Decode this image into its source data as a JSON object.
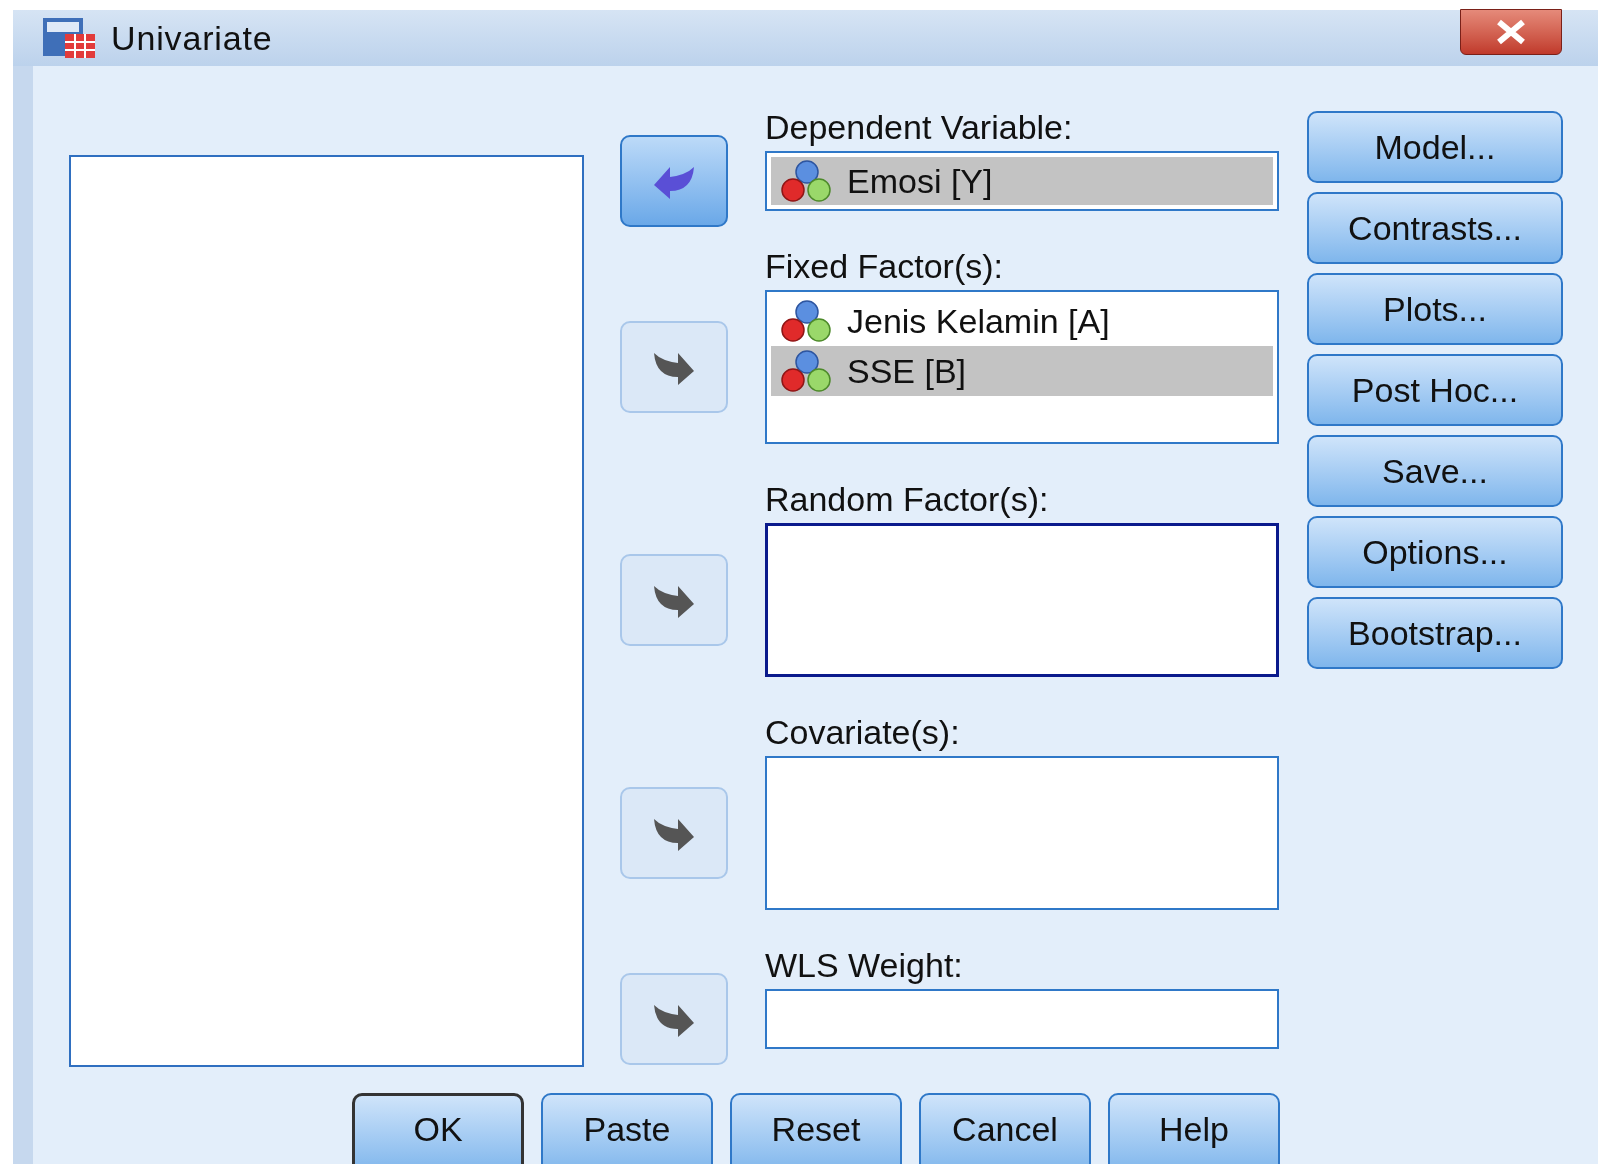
{
  "window": {
    "title": "Univariate"
  },
  "targets": [
    {
      "kind": "single",
      "label": "Dependent Variable:",
      "focused": false,
      "arrow": {
        "reversed": true,
        "disabled": false
      },
      "items": [
        {
          "name": "Emosi [Y]",
          "selected": true
        }
      ]
    },
    {
      "kind": "list",
      "label": "Fixed Factor(s):",
      "focused": false,
      "arrow": {
        "reversed": false,
        "disabled": true
      },
      "items": [
        {
          "name": "Jenis Kelamin [A]",
          "selected": false
        },
        {
          "name": "SSE [B]",
          "selected": true
        }
      ]
    },
    {
      "kind": "list",
      "label": "Random Factor(s):",
      "focused": true,
      "arrow": {
        "reversed": false,
        "disabled": true
      }
    },
    {
      "kind": "list",
      "label": "Covariate(s):",
      "focused": false,
      "arrow": {
        "reversed": false,
        "disabled": true
      }
    },
    {
      "kind": "single",
      "label": "WLS Weight:",
      "focused": false,
      "arrow": {
        "reversed": false,
        "disabled": true
      }
    }
  ],
  "side_buttons": [
    {
      "label": "Model..."
    },
    {
      "label": "Contrasts..."
    },
    {
      "label": "Plots..."
    },
    {
      "label": "Post Hoc..."
    },
    {
      "label": "Save..."
    },
    {
      "label": "Options..."
    },
    {
      "label": "Bootstrap..."
    }
  ],
  "buttons": [
    {
      "label": "OK",
      "default": true
    },
    {
      "label": "Paste",
      "default": false
    },
    {
      "label": "Reset",
      "default": false
    },
    {
      "label": "Cancel",
      "default": false
    },
    {
      "label": "Help",
      "default": false
    }
  ]
}
